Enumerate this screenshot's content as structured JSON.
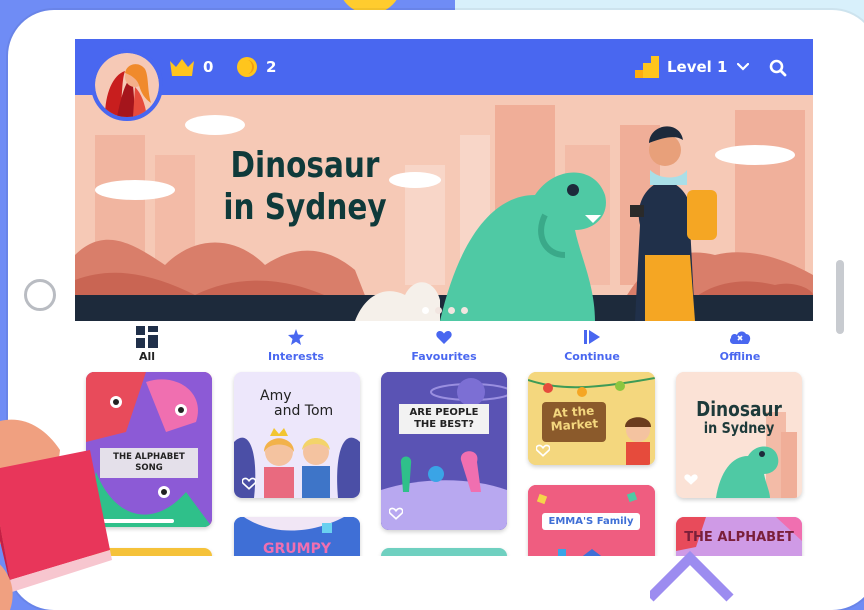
{
  "header": {
    "crowns": "0",
    "coins": "2",
    "level_label": "Level 1"
  },
  "banner": {
    "title": "Dinosaur in Sydney",
    "title_line1": "Dinosaur",
    "title_line2": "in Sydney",
    "dots": 4,
    "active_dot": 0
  },
  "tabs": [
    {
      "label": "All",
      "icon": "grid-icon",
      "active": true
    },
    {
      "label": "Interests",
      "icon": "star-icon",
      "active": false
    },
    {
      "label": "Favourites",
      "icon": "heart-icon",
      "active": false
    },
    {
      "label": "Continue",
      "icon": "continue-icon",
      "active": false
    },
    {
      "label": "Offline",
      "icon": "cloud-offline-icon",
      "active": false
    }
  ],
  "cards": {
    "alphabet_song": "THE ALPHABET SONG",
    "amy_tom_line1": "Amy",
    "amy_tom_line2": "and Tom",
    "people_best": "ARE PEOPLE THE BEST?",
    "market": "At the Market",
    "dinosaur_line1": "Dinosaur",
    "dinosaur_line2": "in Sydney",
    "grumpy": "GRUMPY",
    "emma_family": "EMMA'S Family",
    "alphabet2": "THE ALPHABET"
  },
  "colors": {
    "primary": "#4967f0",
    "banner_bg": "#f6c9b6",
    "coin": "#ffc51d",
    "crown": "#ffc51d"
  }
}
